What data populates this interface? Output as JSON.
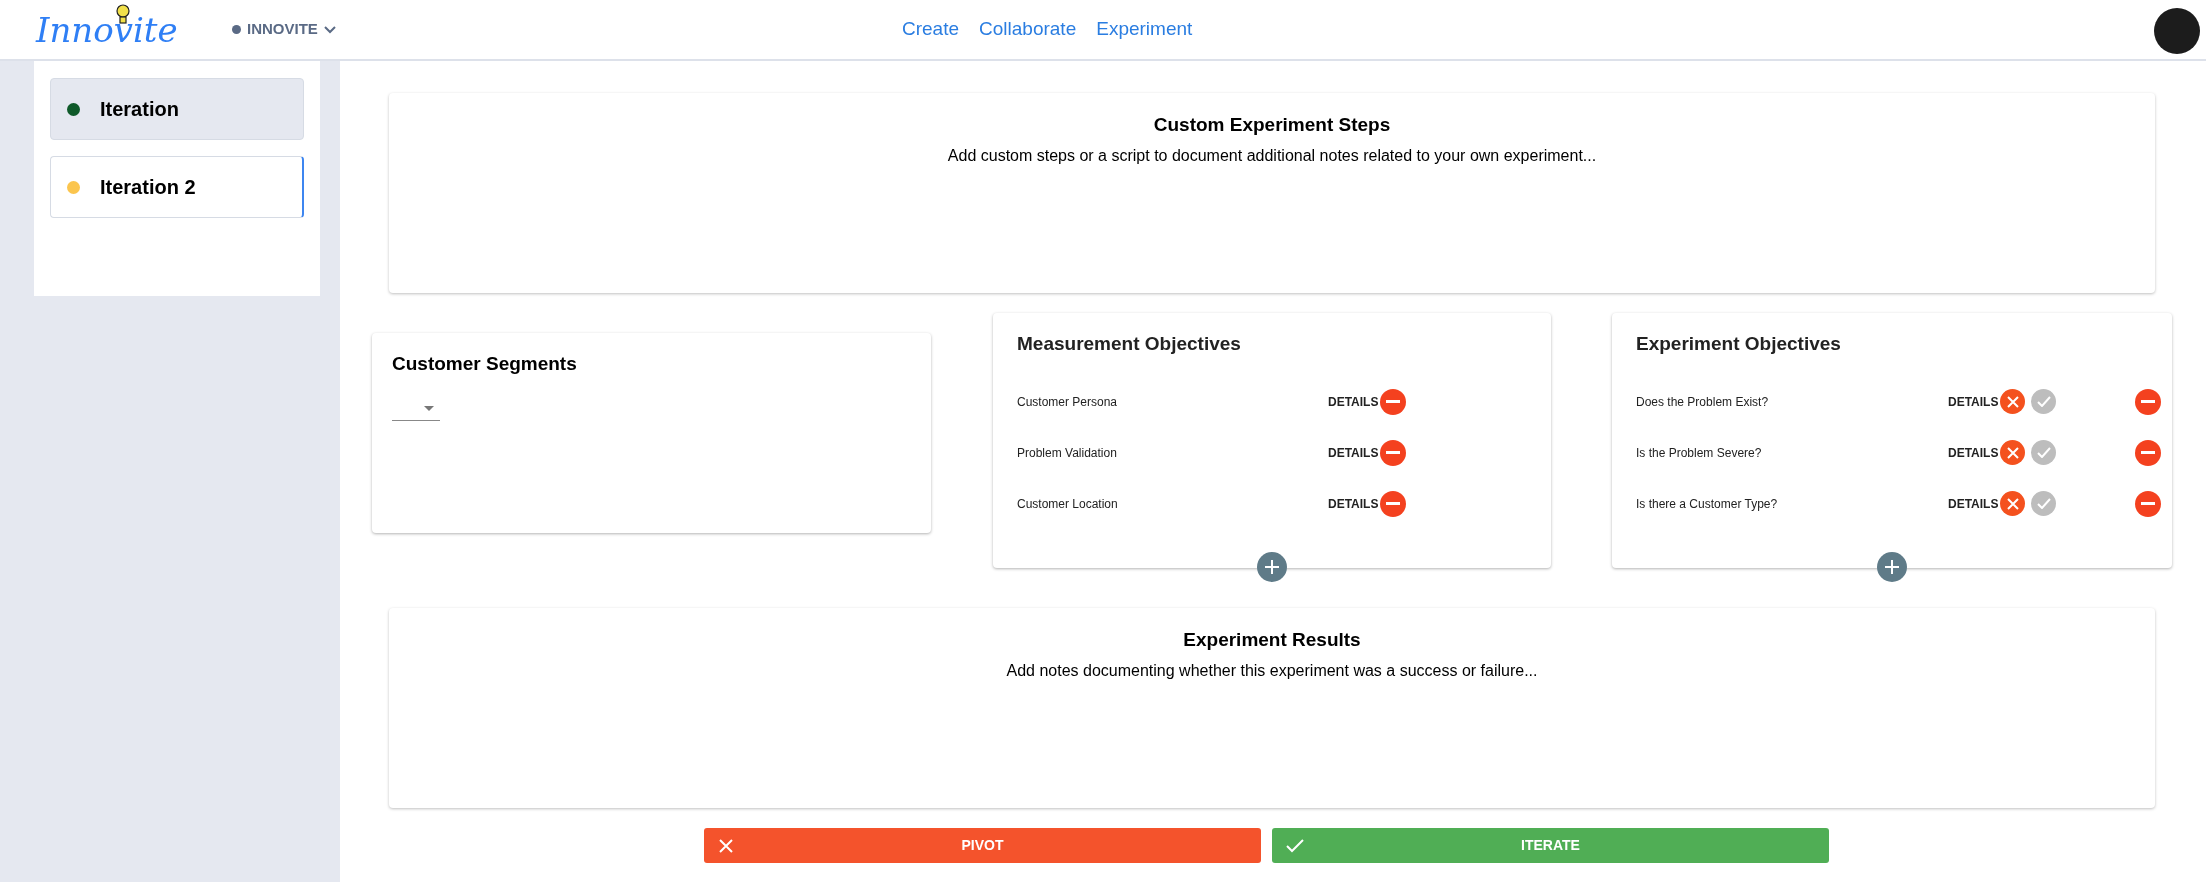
{
  "header": {
    "logo": "Innovite",
    "workspace": "INNOVITE",
    "nav": [
      {
        "label": "Create"
      },
      {
        "label": "Collaborate"
      },
      {
        "label": "Experiment"
      }
    ]
  },
  "sidebar": {
    "items": [
      {
        "label": "Iteration",
        "color": "#0f5a2a",
        "selected": true
      },
      {
        "label": "Iteration 2",
        "color": "#fbc54e",
        "selected": false
      }
    ]
  },
  "custom_steps": {
    "title": "Custom Experiment Steps",
    "subtitle": "Add custom steps or a script to document additional notes related to your own experiment..."
  },
  "customer_segments": {
    "title": "Customer Segments"
  },
  "measurement_objectives": {
    "title": "Measurement Objectives",
    "rows": [
      {
        "label": "Customer Persona",
        "action": "DETAILS"
      },
      {
        "label": "Problem Validation",
        "action": "DETAILS"
      },
      {
        "label": "Customer Location",
        "action": "DETAILS"
      }
    ]
  },
  "experiment_objectives": {
    "title": "Experiment Objectives",
    "rows": [
      {
        "label": "Does the Problem Exist?",
        "action": "DETAILS",
        "failed": true,
        "passed": false
      },
      {
        "label": "Is the Problem Severe?",
        "action": "DETAILS",
        "failed": true,
        "passed": false
      },
      {
        "label": "Is there a Customer Type?",
        "action": "DETAILS",
        "failed": true,
        "passed": false
      }
    ]
  },
  "results": {
    "title": "Experiment Results",
    "subtitle": "Add notes documenting whether this experiment was a success or failure..."
  },
  "actions": [
    {
      "label": "PIVOT",
      "kind": "pivot"
    },
    {
      "label": "ITERATE",
      "kind": "iterate"
    }
  ]
}
